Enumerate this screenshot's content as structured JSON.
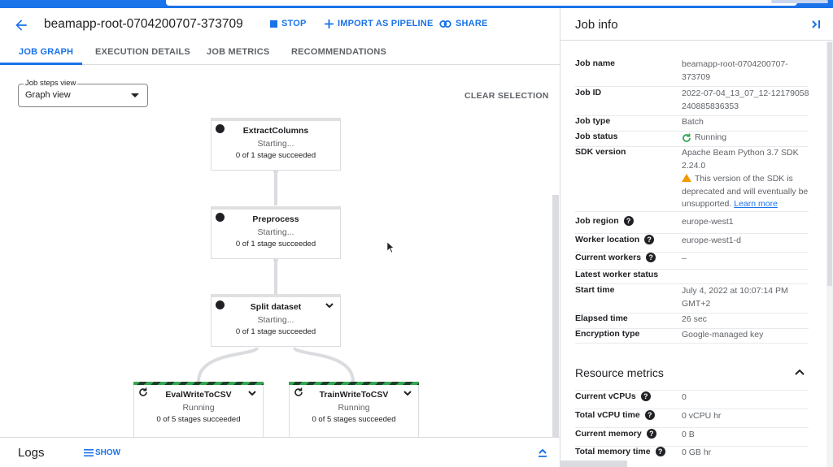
{
  "header": {
    "job_title": "beamapp-root-0704200707-373709",
    "stop_label": "STOP",
    "import_label": "IMPORT AS PIPELINE",
    "share_label": "SHARE"
  },
  "tabs": [
    {
      "label": "JOB GRAPH",
      "active": true
    },
    {
      "label": "EXECUTION DETAILS",
      "active": false
    },
    {
      "label": "JOB METRICS",
      "active": false
    },
    {
      "label": "RECOMMENDATIONS",
      "active": false
    }
  ],
  "graph": {
    "steps_view_label": "Job steps view",
    "steps_view_value": "Graph view",
    "clear_selection": "CLEAR SELECTION",
    "nodes": [
      {
        "name": "ExtractColumns",
        "status": "Starting...",
        "stages": "0 of 1 stage succeeded"
      },
      {
        "name": "Preprocess",
        "status": "Starting...",
        "stages": "0 of 1 stage succeeded"
      },
      {
        "name": "Split dataset",
        "status": "Starting...",
        "stages": "0 of 1 stage succeeded"
      },
      {
        "name": "EvalWriteToCSV",
        "status": "Running",
        "stages": "0 of 5 stages succeeded"
      },
      {
        "name": "TrainWriteToCSV",
        "status": "Running",
        "stages": "0 of 5 stages succeeded"
      }
    ]
  },
  "logs": {
    "title": "Logs",
    "show_label": "SHOW"
  },
  "job_info": {
    "title": "Job info",
    "rows": {
      "job_name": {
        "key": "Job name",
        "value": "beamapp-root-0704200707-373709"
      },
      "job_id": {
        "key": "Job ID",
        "value": "2022-07-04_13_07_12-12179058240885836353"
      },
      "job_type": {
        "key": "Job type",
        "value": "Batch"
      },
      "job_status": {
        "key": "Job status",
        "value": "Running"
      },
      "sdk_version": {
        "key": "SDK version",
        "value": "Apache Beam Python 3.7 SDK 2.24.0",
        "warning": "This version of the SDK is deprecated and will eventually be unsupported.",
        "learn_more": "Learn more"
      },
      "job_region": {
        "key": "Job region",
        "value": "europe-west1"
      },
      "worker_location": {
        "key": "Worker location",
        "value": "europe-west1-d"
      },
      "current_workers": {
        "key": "Current workers",
        "value": "–"
      },
      "latest_worker_status": {
        "key": "Latest worker status",
        "value": ""
      },
      "start_time": {
        "key": "Start time",
        "value": "July 4, 2022 at 10:07:14 PM GMT+2"
      },
      "elapsed_time": {
        "key": "Elapsed time",
        "value": "26 sec"
      },
      "encryption_type": {
        "key": "Encryption type",
        "value": "Google-managed key"
      }
    }
  },
  "resource_metrics": {
    "title": "Resource metrics",
    "rows": {
      "current_vcpus": {
        "key": "Current vCPUs",
        "value": "0"
      },
      "total_vcpu_time": {
        "key": "Total vCPU time",
        "value": "0 vCPU hr"
      },
      "current_memory": {
        "key": "Current memory",
        "value": "0 B"
      },
      "total_memory_time": {
        "key": "Total memory time",
        "value": "0 GB hr"
      }
    }
  },
  "colors": {
    "accent": "#1a73e8",
    "running_green": "#34a853",
    "warning": "#f29900"
  }
}
